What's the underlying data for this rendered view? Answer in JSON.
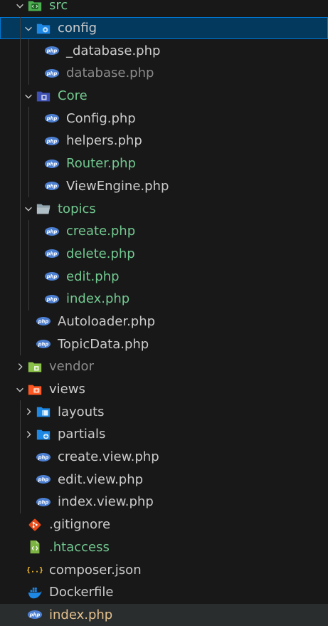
{
  "colors": {
    "default": "#cccccc",
    "untracked_green": "#73c991",
    "ignored_gray": "#8c8c8c",
    "modified_yellow": "#e2c08d",
    "selection_bg": "#04395e",
    "selection_border": "#0078d4",
    "background": "#181818"
  },
  "tree": [
    {
      "label": "src",
      "depth": 0,
      "kind": "folder",
      "expanded": true,
      "icon": "folder-src-icon",
      "color": "green"
    },
    {
      "label": "config",
      "depth": 1,
      "kind": "folder",
      "expanded": true,
      "icon": "folder-config-icon",
      "color": "default",
      "selected": true
    },
    {
      "label": "_database.php",
      "depth": 2,
      "kind": "file",
      "icon": "php-icon",
      "color": "default"
    },
    {
      "label": "database.php",
      "depth": 2,
      "kind": "file",
      "icon": "php-icon",
      "color": "gray"
    },
    {
      "label": "Core",
      "depth": 1,
      "kind": "folder",
      "expanded": true,
      "icon": "folder-core-icon",
      "color": "green"
    },
    {
      "label": "Config.php",
      "depth": 2,
      "kind": "file",
      "icon": "php-icon",
      "color": "default"
    },
    {
      "label": "helpers.php",
      "depth": 2,
      "kind": "file",
      "icon": "php-icon",
      "color": "default"
    },
    {
      "label": "Router.php",
      "depth": 2,
      "kind": "file",
      "icon": "php-icon",
      "color": "green"
    },
    {
      "label": "ViewEngine.php",
      "depth": 2,
      "kind": "file",
      "icon": "php-icon",
      "color": "default"
    },
    {
      "label": "topics",
      "depth": 1,
      "kind": "folder",
      "expanded": true,
      "icon": "folder-open-icon",
      "color": "green"
    },
    {
      "label": "create.php",
      "depth": 2,
      "kind": "file",
      "icon": "php-icon",
      "color": "green"
    },
    {
      "label": "delete.php",
      "depth": 2,
      "kind": "file",
      "icon": "php-icon",
      "color": "green"
    },
    {
      "label": "edit.php",
      "depth": 2,
      "kind": "file",
      "icon": "php-icon",
      "color": "green"
    },
    {
      "label": "index.php",
      "depth": 2,
      "kind": "file",
      "icon": "php-icon",
      "color": "green"
    },
    {
      "label": "Autoloader.php",
      "depth": 1,
      "kind": "file",
      "icon": "php-icon",
      "color": "default"
    },
    {
      "label": "TopicData.php",
      "depth": 1,
      "kind": "file",
      "icon": "php-icon",
      "color": "default"
    },
    {
      "label": "vendor",
      "depth": 0,
      "kind": "folder",
      "expanded": false,
      "icon": "folder-vendor-icon",
      "color": "gray"
    },
    {
      "label": "views",
      "depth": 0,
      "kind": "folder",
      "expanded": true,
      "icon": "folder-views-icon",
      "color": "default"
    },
    {
      "label": "layouts",
      "depth": 1,
      "kind": "folder",
      "expanded": false,
      "icon": "folder-layouts-icon",
      "color": "default"
    },
    {
      "label": "partials",
      "depth": 1,
      "kind": "folder",
      "expanded": false,
      "icon": "folder-partials-icon",
      "color": "default"
    },
    {
      "label": "create.view.php",
      "depth": 1,
      "kind": "file",
      "icon": "php-icon",
      "color": "default"
    },
    {
      "label": "edit.view.php",
      "depth": 1,
      "kind": "file",
      "icon": "php-icon",
      "color": "default"
    },
    {
      "label": "index.view.php",
      "depth": 1,
      "kind": "file",
      "icon": "php-icon",
      "color": "default"
    },
    {
      "label": ".gitignore",
      "depth": 0,
      "kind": "file",
      "icon": "git-icon",
      "color": "default"
    },
    {
      "label": ".htaccess",
      "depth": 0,
      "kind": "file",
      "icon": "htaccess-icon",
      "color": "green"
    },
    {
      "label": "composer.json",
      "depth": 0,
      "kind": "file",
      "icon": "json-icon",
      "color": "default"
    },
    {
      "label": "Dockerfile",
      "depth": 0,
      "kind": "file",
      "icon": "docker-icon",
      "color": "default"
    },
    {
      "label": "index.php",
      "depth": 0,
      "kind": "file",
      "icon": "php-icon",
      "color": "yellow",
      "hovered": true
    }
  ]
}
